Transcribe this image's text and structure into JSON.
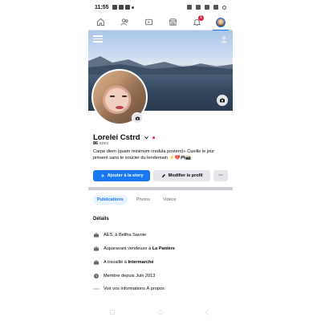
{
  "status_bar": {
    "time": "11:55"
  },
  "nav": {
    "items": [
      {
        "name": "home-icon"
      },
      {
        "name": "friends-icon"
      },
      {
        "name": "watch-icon"
      },
      {
        "name": "marketplace-icon"
      },
      {
        "name": "notifications-icon",
        "badge": "1"
      },
      {
        "name": "profile-avatar-icon",
        "active": true
      }
    ],
    "accent": "#1877f2"
  },
  "profile": {
    "name": "Lorelei Cstrd",
    "friends_count": "86",
    "friends_label": "amis",
    "bio": "Carpe diem (quam minimum credula postero)» Cueille le jour présent sans te soucier du lendemain ⚡️💔🎮📸"
  },
  "actions": {
    "add_story": "Ajouter à la story",
    "edit_profile": "Modifier le profil",
    "more": "···"
  },
  "tabs": [
    {
      "label": "Publications",
      "active": true
    },
    {
      "label": "Photos",
      "active": false
    },
    {
      "label": "Vidéos",
      "active": false
    }
  ],
  "details": {
    "title": "Détails",
    "items": [
      {
        "icon": "work-icon",
        "prefix": "AES, à Bellha Savoie",
        "bold": ""
      },
      {
        "icon": "work-icon",
        "prefix": "Auparavant vendeuse à ",
        "bold": "La Panière"
      },
      {
        "icon": "work-icon",
        "prefix": "A travaillé à ",
        "bold": "Intermarché"
      },
      {
        "icon": "clock-icon",
        "prefix": "Membre depuis Juin 2013",
        "bold": ""
      },
      {
        "icon": "more-icon",
        "prefix": "Voir vos informations À propos",
        "bold": ""
      }
    ]
  }
}
